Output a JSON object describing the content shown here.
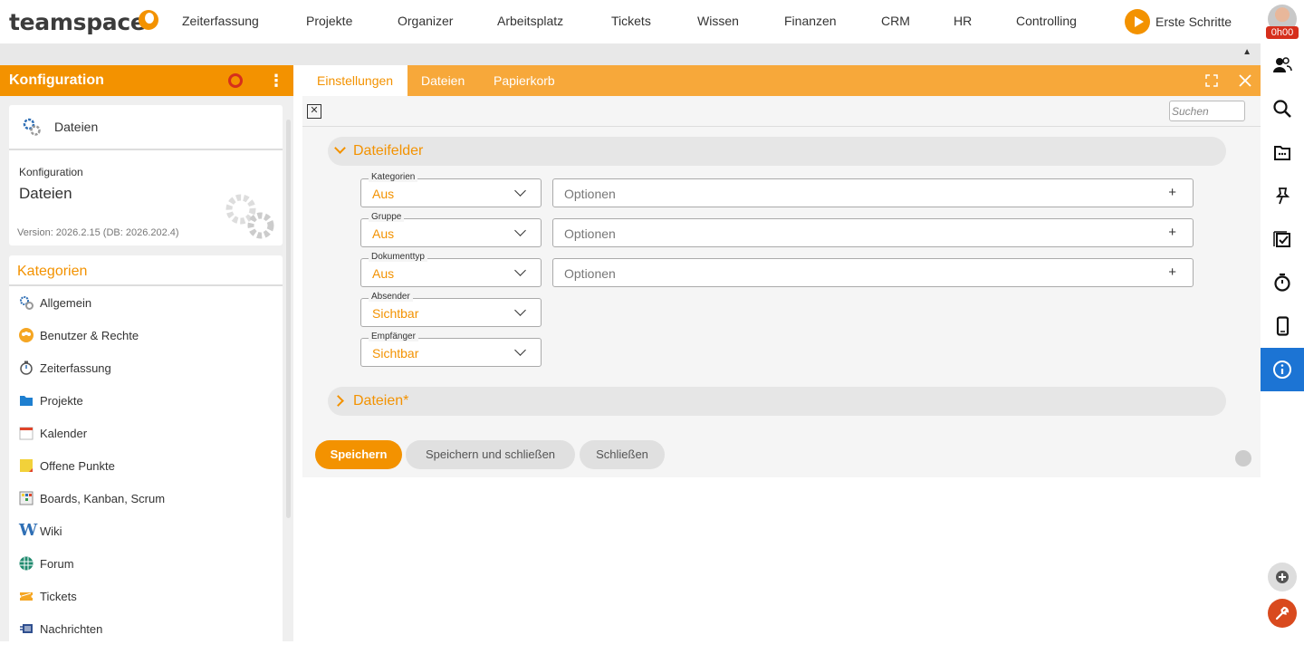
{
  "logo": "teamspace",
  "nav": [
    "Zeiterfassung",
    "Projekte",
    "Organizer",
    "Arbeitsplatz",
    "Tickets",
    "Wissen",
    "Finanzen",
    "CRM",
    "HR",
    "Controlling"
  ],
  "first_steps": "Erste Schritte",
  "timer": "0h00",
  "left": {
    "title": "Konfiguration",
    "current_item": "Dateien",
    "config_label": "Konfiguration",
    "config_name": "Dateien",
    "version": "Version: 2026.2.15 (DB: 2026.202.4)",
    "categories_title": "Kategorien",
    "categories": [
      {
        "label": "Allgemein",
        "icon": "gears-icon"
      },
      {
        "label": "Benutzer & Rechte",
        "icon": "users-icon"
      },
      {
        "label": "Zeiterfassung",
        "icon": "stopwatch-icon"
      },
      {
        "label": "Projekte",
        "icon": "folder-icon"
      },
      {
        "label": "Kalender",
        "icon": "calendar-icon"
      },
      {
        "label": "Offene Punkte",
        "icon": "note-icon"
      },
      {
        "label": "Boards, Kanban, Scrum",
        "icon": "board-icon"
      },
      {
        "label": "Wiki",
        "icon": "wiki-icon"
      },
      {
        "label": "Forum",
        "icon": "forum-icon"
      },
      {
        "label": "Tickets",
        "icon": "ticket-icon"
      },
      {
        "label": "Nachrichten",
        "icon": "messages-icon"
      }
    ]
  },
  "tabs": [
    "Einstellungen",
    "Dateien",
    "Papierkorb"
  ],
  "search_placeholder": "Suchen",
  "sections": {
    "dateifelder": "Dateifelder",
    "dateien": "Dateien*"
  },
  "fields": [
    {
      "label": "Kategorien",
      "value": "Aus",
      "options": "Optionen",
      "plus": "+"
    },
    {
      "label": "Gruppe",
      "value": "Aus",
      "options": "Optionen",
      "plus": "+"
    },
    {
      "label": "Dokumenttyp",
      "value": "Aus",
      "options": "Optionen",
      "plus": "+"
    },
    {
      "label": "Absender",
      "value": "Sichtbar"
    },
    {
      "label": "Empfänger",
      "value": "Sichtbar"
    }
  ],
  "buttons": {
    "save": "Speichern",
    "save_close": "Speichern und schließen",
    "close": "Schließen"
  },
  "colors": {
    "accent": "#f39200",
    "tab_bar": "#f7a83a",
    "active_sidebar": "#1c74d4",
    "alert": "#d62f1c"
  }
}
